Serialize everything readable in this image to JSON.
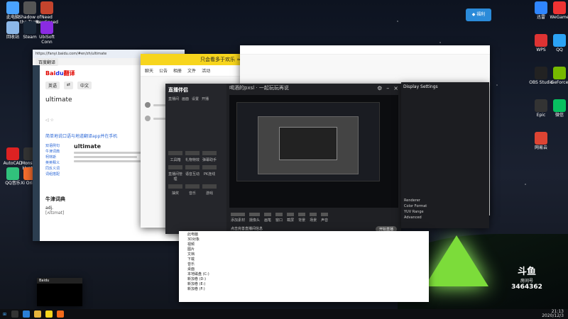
{
  "desktop_icons_left": [
    {
      "label": "此电脑",
      "color": "#4aa3ff"
    },
    {
      "label": "Shadow of the Tomb",
      "color": "#555"
    },
    {
      "label": "Need NewSpeed",
      "color": "#c4442d"
    },
    {
      "label": "回收站",
      "color": "#8cb7e8"
    },
    {
      "label": "Steam",
      "color": "#1b2838"
    },
    {
      "label": "UbiSoft Conn",
      "color": "#8a2be2"
    },
    {
      "label": "AutoCAD",
      "color": "#d22"
    },
    {
      "label": "Monster Hunter",
      "color": "#333"
    },
    {
      "label": "EPIC Games",
      "color": "#222"
    },
    {
      "label": "QQ音乐",
      "color": "#31c27c"
    },
    {
      "label": "Xi Origin",
      "color": "#f56c2d"
    },
    {
      "label": "AIDA64",
      "color": "#444"
    }
  ],
  "desktop_icons_right": [
    {
      "label": "迅雷",
      "color": "#2f86ff"
    },
    {
      "label": "WeGame",
      "color": "#e33"
    },
    {
      "label": "WPS",
      "color": "#d33"
    },
    {
      "label": "QQ",
      "color": "#2ba3f5"
    },
    {
      "label": "OBS Studio",
      "color": "#222"
    },
    {
      "label": "GeForce",
      "color": "#76b900"
    },
    {
      "label": "Epic",
      "color": "#333"
    },
    {
      "label": "微信",
      "color": "#07c160"
    },
    {
      "label": "网易云",
      "color": "#d43"
    }
  ],
  "browser": {
    "url": "https://fanyi.baidu.com/#en/zh/ultimate",
    "tab_label": "百度翻译",
    "query": "ultimate",
    "headword": "ultimate",
    "notice": "简单地说口语与地道翻译app并在手机",
    "sidebar_links": [
      "双语例句",
      "牛津词典",
      "柯林斯",
      "英英释义",
      "同反义词",
      "词组搭配"
    ],
    "bottom_title": "牛津词典",
    "bottom_word": "adj.",
    "bottom_phonetic": "[ʌltɪmət]"
  },
  "chat_window": {
    "title": "只会看多于欢乐 ≈ 5",
    "tabs": [
      "聊天",
      "公告",
      "相册",
      "文件",
      "活动"
    ]
  },
  "livestream": {
    "brand": "直播伴侣",
    "title": "喝酒的pxsl · 一起玩玩再说",
    "toolbar": [
      "直播间",
      "画面",
      "设置",
      "开播"
    ],
    "tools": [
      "工具箱",
      "礼物特效",
      "弹幕助手",
      "直播间管理",
      "语音互动",
      "PK连线",
      "抽奖",
      "音乐",
      "游戏"
    ],
    "bottom_actions": [
      "添加素材",
      "摄像头",
      "画笔",
      "窗口",
      "截屏",
      "背景",
      "场景",
      "声音"
    ],
    "start_label": "开始直播",
    "footer": "点击完善直播间信息"
  },
  "explorer": {
    "items": [
      "此电脑",
      "3D对象",
      "视频",
      "图片",
      "文档",
      "下载",
      "音乐",
      "桌面",
      "本地磁盘 (C:)",
      "新加卷 (D:)",
      "新加卷 (E:)",
      "新加卷 (F:)"
    ]
  },
  "obs_panel": {
    "title": "Display Settings",
    "items": [
      "Renderer",
      "Color Format",
      "YUV Range",
      "Advanced"
    ]
  },
  "dock": {
    "brand": "斗鱼",
    "subtitle": "房间号",
    "room": "3464362"
  },
  "taskbar": {
    "time": "21:13",
    "date": "2020/12/3"
  },
  "small_preview": {
    "title": "Baidu"
  }
}
